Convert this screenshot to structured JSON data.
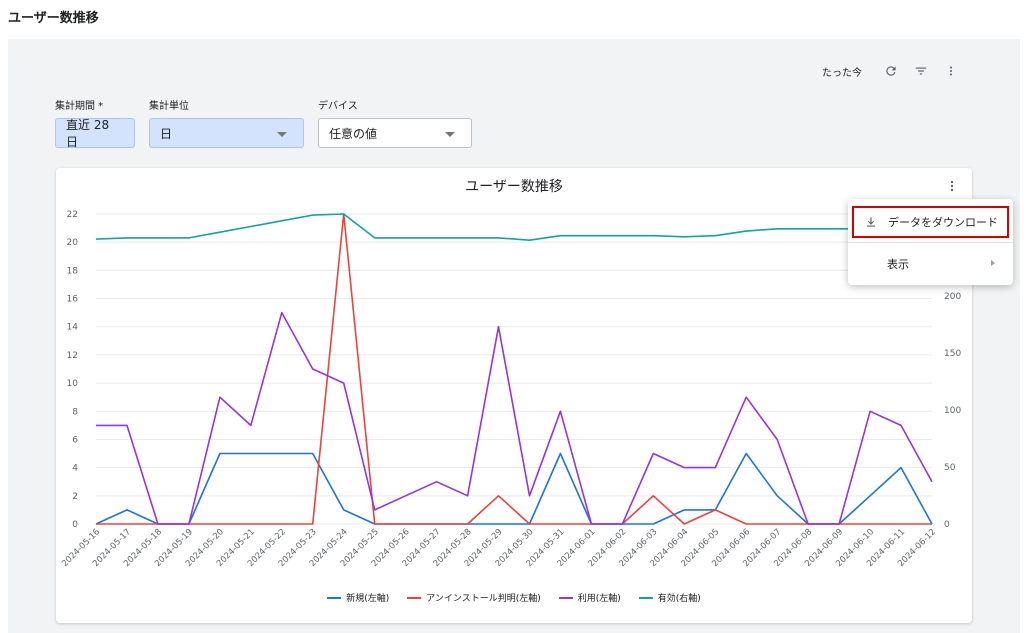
{
  "page": {
    "title": "ユーザー数推移"
  },
  "toolbar": {
    "updated_label": "たった今"
  },
  "filters": [
    {
      "label": "集計期間 *",
      "value": "直近 28 日",
      "kind": "date"
    },
    {
      "label": "集計単位",
      "value": "日",
      "kind": "select"
    },
    {
      "label": "デバイス",
      "value": "任意の値",
      "kind": "select"
    }
  ],
  "card": {
    "title": "ユーザー数推移"
  },
  "menu": {
    "download_label": "データをダウンロード",
    "view_label": "表示"
  },
  "colors": {
    "new": "#1a73e8",
    "uninstall": "#e8453c",
    "usage": "#9334e6",
    "active": "#12a4a0"
  },
  "chart_data": {
    "type": "line",
    "title": "ユーザー数推移",
    "x": [
      "2024-05-16",
      "2024-05-17",
      "2024-05-18",
      "2024-05-19",
      "2024-05-20",
      "2024-05-21",
      "2024-05-22",
      "2024-05-23",
      "2024-05-24",
      "2024-05-25",
      "2024-05-26",
      "2024-05-27",
      "2024-05-28",
      "2024-05-29",
      "2024-05-30",
      "2024-05-31",
      "2024-06-01",
      "2024-06-02",
      "2024-06-03",
      "2024-06-04",
      "2024-06-05",
      "2024-06-06",
      "2024-06-07",
      "2024-06-08",
      "2024-06-09",
      "2024-06-10",
      "2024-06-11",
      "2024-06-12"
    ],
    "y_left_ticks": [
      0,
      2,
      4,
      6,
      8,
      10,
      12,
      14,
      16,
      18,
      20,
      22
    ],
    "y_left_range": [
      0,
      22
    ],
    "y_right_ticks": [
      0,
      50,
      100,
      150,
      200
    ],
    "y_right_range": [
      0,
      272
    ],
    "grid": true,
    "legend_position": "bottom",
    "series": [
      {
        "name": "新規(左軸)",
        "axis": "left",
        "values": [
          0,
          1,
          0,
          0,
          5,
          5,
          5,
          5,
          1,
          0,
          0,
          0,
          0,
          0,
          0,
          5,
          0,
          0,
          0,
          1,
          1,
          5,
          2,
          0,
          0,
          2,
          4,
          0
        ]
      },
      {
        "name": "アンインストール判明(左軸)",
        "axis": "left",
        "values": [
          0,
          0,
          0,
          0,
          0,
          0,
          0,
          0,
          22,
          0,
          0,
          0,
          0,
          2,
          0,
          0,
          0,
          0,
          2,
          0,
          1,
          0,
          0,
          0,
          0,
          0,
          0,
          0
        ]
      },
      {
        "name": "利用(左軸)",
        "axis": "left",
        "values": [
          7,
          7,
          0,
          0,
          9,
          7,
          15,
          11,
          10,
          1,
          2,
          3,
          2,
          14,
          2,
          8,
          0,
          0,
          5,
          4,
          4,
          9,
          6,
          0,
          0,
          8,
          7,
          3
        ]
      },
      {
        "name": "有効(右軸)",
        "axis": "right",
        "values": [
          250,
          251,
          251,
          251,
          256,
          261,
          266,
          271,
          272,
          251,
          251,
          251,
          251,
          251,
          249,
          253,
          253,
          253,
          253,
          252,
          253,
          257,
          259,
          259,
          259,
          259,
          261,
          262
        ]
      }
    ]
  }
}
